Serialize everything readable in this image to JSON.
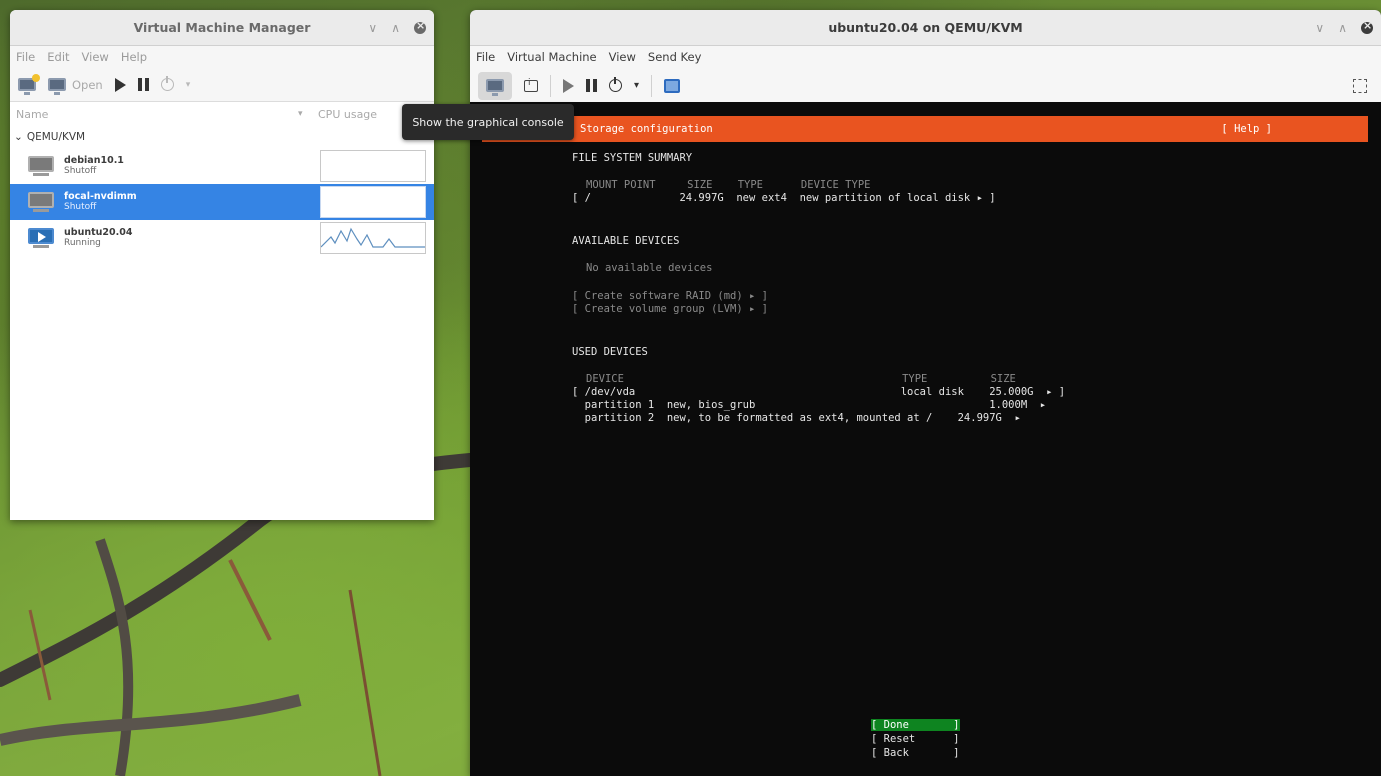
{
  "vmm": {
    "title": "Virtual Machine Manager",
    "menu": [
      "File",
      "Edit",
      "View",
      "Help"
    ],
    "toolbar": {
      "open_label": "Open"
    },
    "columns": {
      "name": "Name",
      "cpu": "CPU usage"
    },
    "group": "QEMU/KVM",
    "vms": [
      {
        "name": "debian10.1",
        "status": "Shutoff",
        "selected": false
      },
      {
        "name": "focal-nvdimm",
        "status": "Shutoff",
        "selected": true
      },
      {
        "name": "ubuntu20.04",
        "status": "Running",
        "selected": false
      }
    ]
  },
  "tooltip": "Show the graphical console",
  "qemu": {
    "title": "ubuntu20.04 on QEMU/KVM",
    "menu": [
      "File",
      "Virtual Machine",
      "View",
      "Send Key"
    ]
  },
  "console": {
    "header": "Storage configuration",
    "help": "[ Help ]",
    "fs_summary_title": "FILE SYSTEM SUMMARY",
    "fs_cols": "MOUNT POINT     SIZE    TYPE      DEVICE TYPE",
    "fs_row": "[ /              24.997G  new ext4  new partition of local disk ▸ ]",
    "available_title": "AVAILABLE DEVICES",
    "no_devices": "No available devices",
    "create_raid": "[ Create software RAID (md) ▸ ]",
    "create_lvm": "[ Create volume group (LVM) ▸ ]",
    "used_title": "USED DEVICES",
    "used_cols": "DEVICE                                            TYPE          SIZE",
    "used_rows": [
      "[ /dev/vda                                          local disk    25.000G  ▸ ]",
      "  partition 1  new, bios_grub                                     1.000M  ▸",
      "  partition 2  new, to be formatted as ext4, mounted at /    24.997G  ▸"
    ],
    "buttons": {
      "done": "[ Done       ]",
      "reset": "[ Reset      ]",
      "back": "[ Back       ]"
    }
  }
}
